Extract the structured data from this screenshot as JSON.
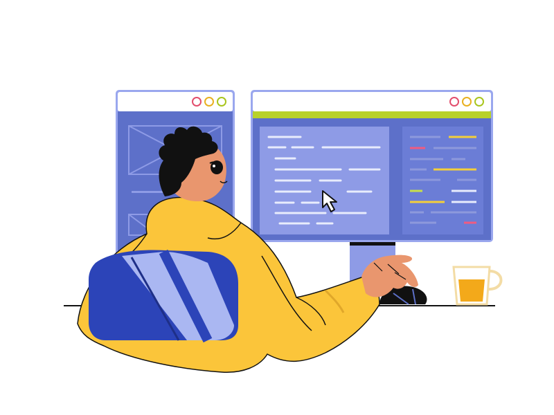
{
  "scene": {
    "description_icons": [
      "browser-window-icon",
      "cursor-arrow-icon",
      "coffee-cup-icon"
    ],
    "colors": {
      "background": "#ffffff",
      "window_frame": "#9aa7ee",
      "window_titlebar": "#ffffff",
      "window_body": "#5d70c9",
      "window_panel_light": "#8e9be6",
      "window_panel_dark": "#6b7dd6",
      "accent_bar": "#b8d12a",
      "dot_red": "#e24d6c",
      "dot_yellow": "#e8b01f",
      "dot_green": "#a9c51d",
      "code_white": "#e8ecfc",
      "code_grey": "#8d99dc",
      "code_yellow": "#f4cf3a",
      "code_pink": "#f05b80",
      "code_green": "#c8e04a",
      "hoodie": "#fbc53a",
      "skin": "#e9966e",
      "hair": "#111111",
      "chair_dark": "#2c44b8",
      "chair_light": "#aab7f2",
      "coffee": "#f3a91a",
      "desk_line": "#111111"
    }
  }
}
